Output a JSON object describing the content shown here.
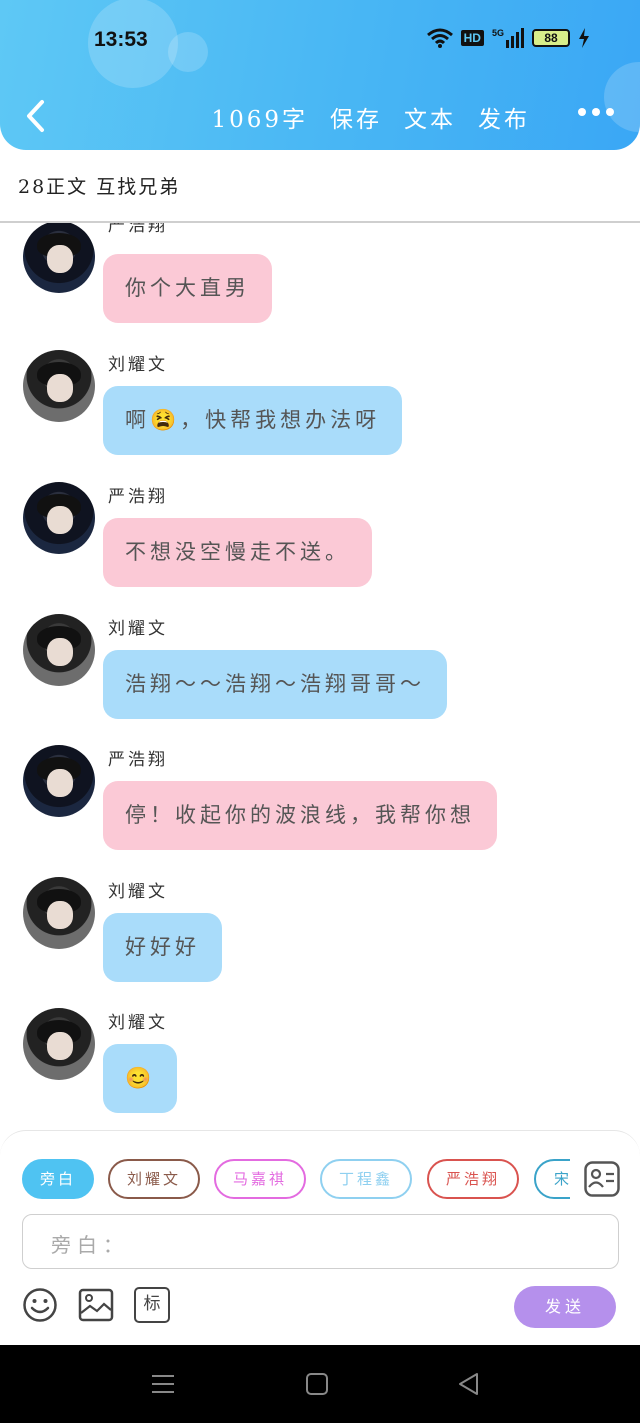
{
  "status_bar": {
    "time": "13:53",
    "network": "HD",
    "signal": "5G",
    "battery": "88"
  },
  "toolbar": {
    "word_count": "1069字",
    "save": "保存",
    "text": "文本",
    "publish": "发布"
  },
  "chapter_title": "28正文  互找兄弟",
  "messages": [
    {
      "name": "严浩翔",
      "text": "你个大直男",
      "color": "pink"
    },
    {
      "name": "刘耀文",
      "text": "啊😫，快帮我想办法呀",
      "color": "blue"
    },
    {
      "name": "严浩翔",
      "text": "不想没空慢走不送。",
      "color": "pink"
    },
    {
      "name": "刘耀文",
      "text": "浩翔～～浩翔～浩翔哥哥～",
      "color": "blue"
    },
    {
      "name": "严浩翔",
      "text": "停！收起你的波浪线，我帮你想",
      "color": "pink"
    },
    {
      "name": "刘耀文",
      "text": "好好好",
      "color": "blue"
    },
    {
      "name": "刘耀文",
      "text": "😊",
      "color": "blue"
    }
  ],
  "roles": [
    {
      "label": "旁白",
      "color": "#4fc3f2",
      "selected": true
    },
    {
      "label": "刘耀文",
      "color": "#8a5a4a",
      "selected": false
    },
    {
      "label": "马嘉祺",
      "color": "#e36be0",
      "selected": false
    },
    {
      "label": "丁程鑫",
      "color": "#8fd0f0",
      "selected": false
    },
    {
      "label": "严浩翔",
      "color": "#d9534f",
      "selected": false
    },
    {
      "label": "宋",
      "color": "#3aa3c9",
      "selected": false
    }
  ],
  "input": {
    "placeholder": "旁白："
  },
  "tools": {
    "tag_label": "标"
  },
  "send_label": "发送",
  "colors": {
    "header": "#48b6f4",
    "pink_bubble": "#fbc9d6",
    "blue_bubble": "#a9dcfa",
    "send": "#b590ec"
  }
}
